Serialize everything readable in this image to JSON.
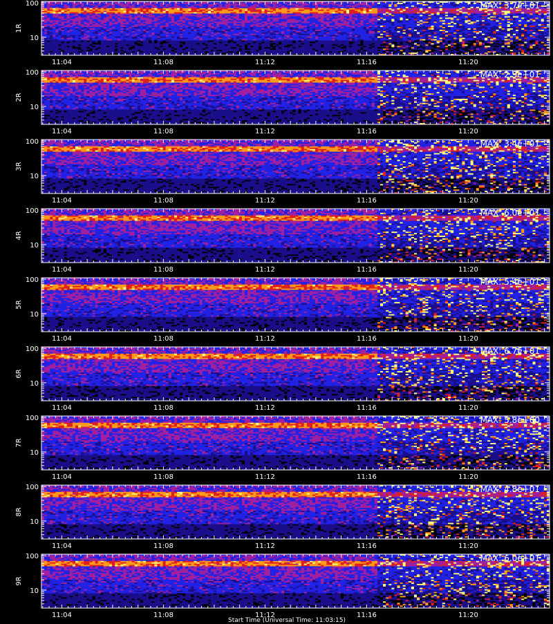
{
  "chart_data": {
    "type": "heatmap",
    "x_axis": {
      "tick_labels": [
        "11:04",
        "11:08",
        "11:12",
        "11:16",
        "11:20"
      ],
      "tick_minutes": [
        4,
        8,
        12,
        16,
        20
      ],
      "range_minutes": [
        3.2,
        23.2
      ],
      "title": "Start Time (Universal Time: 11:03:15)"
    },
    "y_axis": {
      "scale": "log",
      "range": [
        3,
        110
      ],
      "tick_labels": [
        "10",
        "100"
      ],
      "tick_values": [
        10,
        100
      ]
    },
    "colormap": [
      "#000000",
      "#1a0e8a",
      "#2222e6",
      "#a020a0",
      "#e0201c",
      "#ff9a1a",
      "#ffff80"
    ],
    "panels": [
      {
        "label": "1R",
        "max_text": "MAX: 3.7e+01"
      },
      {
        "label": "2R",
        "max_text": "MAX: 2.9e+01"
      },
      {
        "label": "3R",
        "max_text": "MAX: 3.4e+01"
      },
      {
        "label": "4R",
        "max_text": "MAX: 6.0e+01"
      },
      {
        "label": "5R",
        "max_text": "MAX: 5.4e+01"
      },
      {
        "label": "6R",
        "max_text": "MAX: 6.7e+01"
      },
      {
        "label": "7R",
        "max_text": "MAX: 5.8e+00"
      },
      {
        "label": "8R",
        "max_text": "MAX: 4.8e+01"
      },
      {
        "label": "9R",
        "max_text": "MAX: 6.0e+01"
      }
    ],
    "grid": false
  }
}
